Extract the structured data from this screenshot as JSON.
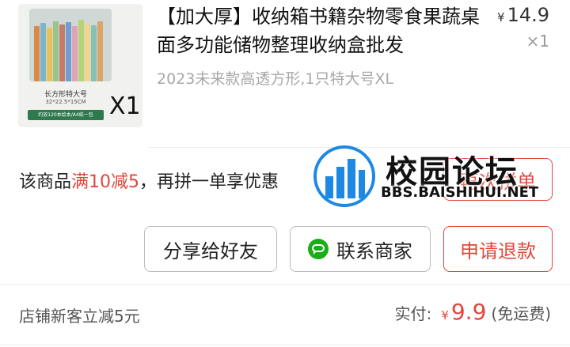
{
  "product": {
    "image": {
      "caption": "长方形特大号",
      "dims": "32*22.5*15CM",
      "band": "约放120本绘本/A4纸一包",
      "quantity_overlay": "X1"
    },
    "title": "【加大厚】收纳箱书籍杂物零食果蔬桌面多功能储物整理收纳盒批发",
    "price_currency": "¥",
    "price": "14.9",
    "count": "×1",
    "spec": "2023未来款高透方形,1只特大号XL"
  },
  "promo": {
    "prefix": "该商品",
    "highlight": "满10减5",
    "suffix": "，再拼一单享优惠"
  },
  "buttons": {
    "rebuy": "再次拼单",
    "share": "分享给好友",
    "contact": "联系商家",
    "refund": "申请退款"
  },
  "footer": {
    "discount": "店铺新客立减5元",
    "paid_label": "实付:",
    "currency": "¥",
    "amount": "9.9",
    "shipping_note": "(免运费)"
  },
  "watermark": {
    "name": "校园论坛",
    "url": "BBS.BAISHIHUI.NET"
  },
  "colors": {
    "accent": "#e2473b",
    "wechat": "#1aad19"
  }
}
